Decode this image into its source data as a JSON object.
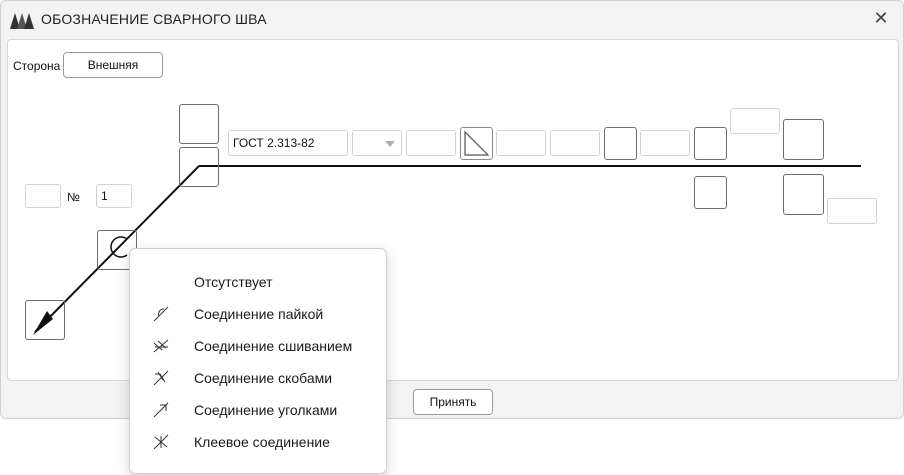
{
  "window": {
    "title": "ОБОЗНАЧЕНИЕ СВАРНОГО ШВА",
    "close_glyph": "✕"
  },
  "side": {
    "label": "Сторона",
    "value": "Внешняя"
  },
  "number": {
    "label": "№",
    "value": "1"
  },
  "standard": {
    "value": "ГОСТ 2.313-82"
  },
  "accept_label": "Принять",
  "menu": {
    "items": [
      {
        "label": "Отсутствует",
        "icon": "none"
      },
      {
        "label": "Соединение пайкой",
        "icon": "solder-joint-icon"
      },
      {
        "label": "Соединение сшиванием",
        "icon": "stitch-joint-icon"
      },
      {
        "label": "Соединение скобами",
        "icon": "staple-joint-icon"
      },
      {
        "label": "Соединение уголками",
        "icon": "angle-joint-icon"
      },
      {
        "label": "Клеевое соединение",
        "icon": "adhesive-joint-icon"
      }
    ]
  }
}
